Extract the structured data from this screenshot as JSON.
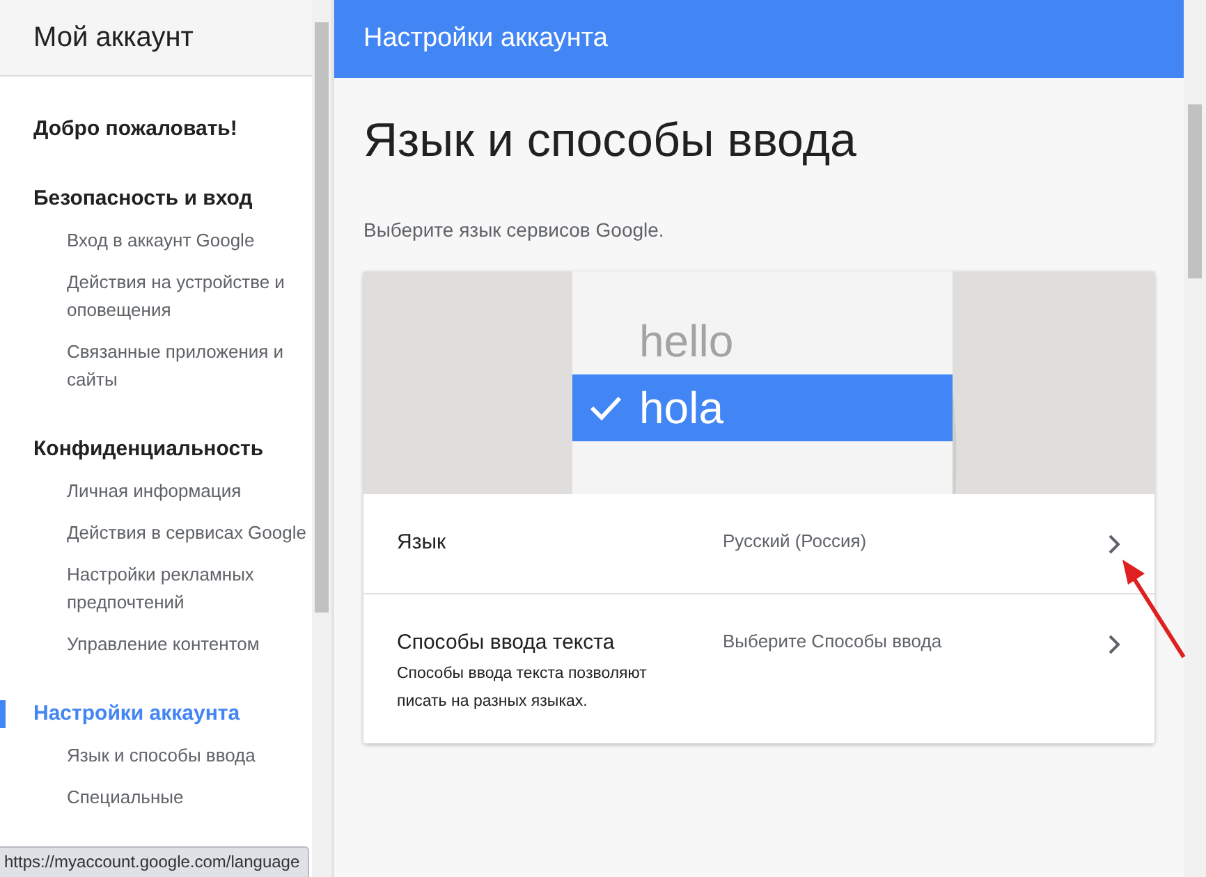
{
  "sidebar": {
    "title": "Мой аккаунт",
    "sections": [
      {
        "title": "Добро пожаловать!",
        "selected": false
      },
      {
        "title": "Безопасность и вход",
        "selected": false,
        "items": [
          {
            "label": "Вход в аккаунт Google"
          },
          {
            "label": "Действия на устройстве и оповещения"
          },
          {
            "label": "Связанные приложения и сайты"
          }
        ]
      },
      {
        "title": "Конфиденциальность",
        "selected": false,
        "items": [
          {
            "label": "Личная информация"
          },
          {
            "label": "Действия в сервисах Google"
          },
          {
            "label": "Настройки рекламных предпочтений"
          },
          {
            "label": "Управление контентом"
          }
        ]
      },
      {
        "title": "Настройки аккаунта",
        "selected": true,
        "items": [
          {
            "label": "Язык и способы ввода"
          },
          {
            "label": "Специальные"
          }
        ]
      }
    ]
  },
  "header": {
    "title": "Настройки аккаунта"
  },
  "page": {
    "title": "Язык и способы ввода",
    "subtitle": "Выберите язык сервисов Google."
  },
  "illustration_words": [
    {
      "text": "hello",
      "selected": false
    },
    {
      "text": "hola",
      "selected": true
    }
  ],
  "settings": [
    {
      "label": "Язык",
      "value": "Русский (Россия)"
    },
    {
      "label": "Способы ввода текста",
      "description": "Способы ввода текста позволяют писать на разных языках.",
      "value": "Выберите Способы ввода"
    }
  ],
  "status_bar": {
    "url": "https://myaccount.google.com/language"
  }
}
